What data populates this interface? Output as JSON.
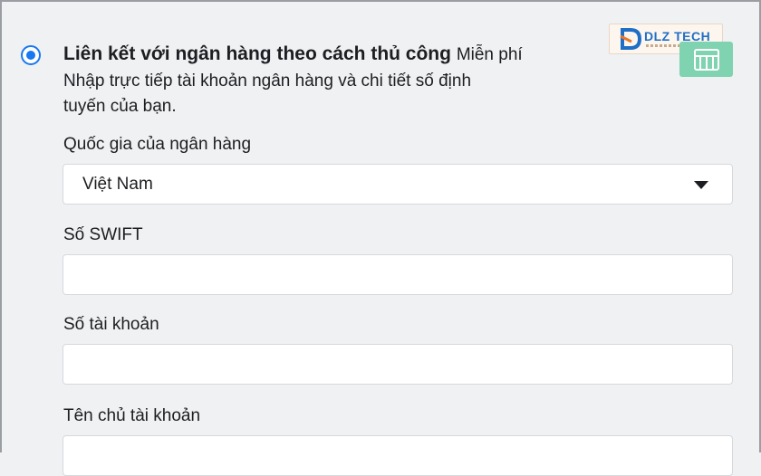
{
  "option": {
    "title": "Liên kết với ngân hàng theo cách thủ công",
    "price": "Miễn phí",
    "description": "Nhập trực tiếp tài khoản ngân hàng và chi tiết số định tuyến của bạn."
  },
  "logo": {
    "text": "DLZ TECH",
    "mark": "D"
  },
  "icons": {
    "bank": "bank-icon",
    "radio": "radio-selected"
  },
  "colors": {
    "accent": "#1877f2",
    "bank_icon_bg": "#7fd3b0",
    "logo_blue": "#1f6fc7"
  },
  "form": {
    "country_label": "Quốc gia của ngân hàng",
    "country_value": "Việt Nam",
    "swift_label": "Số SWIFT",
    "swift_value": "",
    "account_label": "Số tài khoản",
    "account_value": "",
    "holder_label": "Tên chủ tài khoản",
    "holder_value": ""
  }
}
